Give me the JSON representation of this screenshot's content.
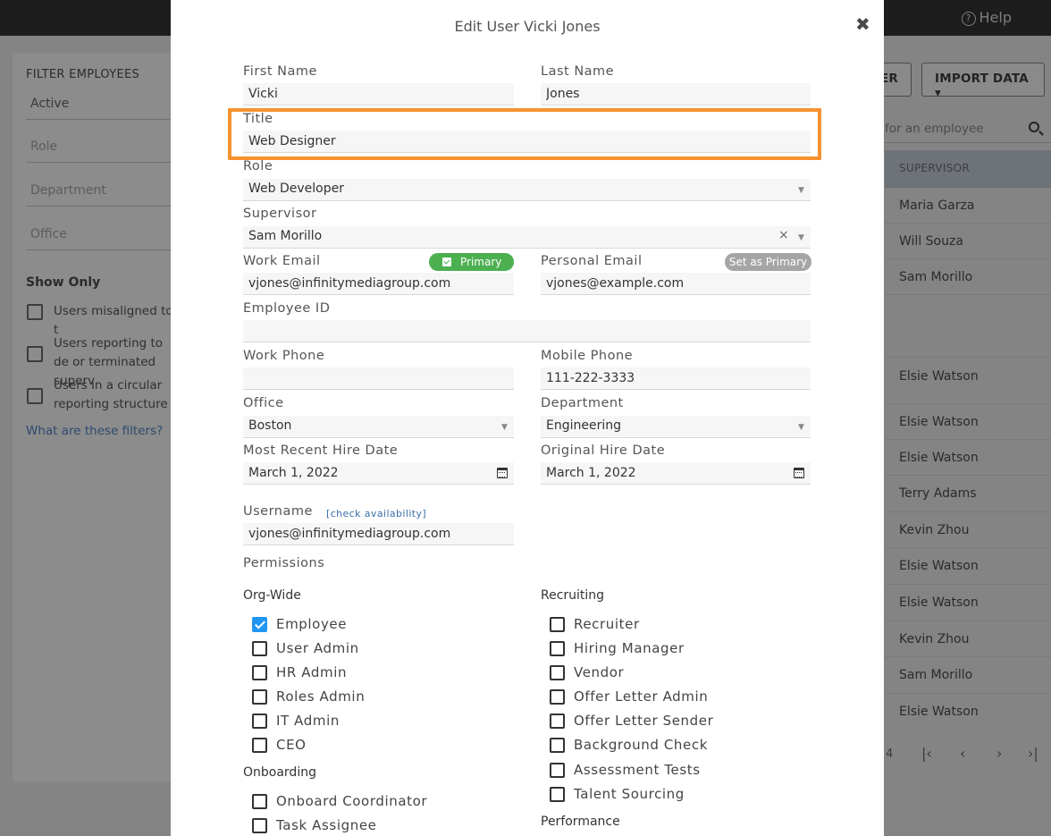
{
  "background": {
    "help_label": "Help",
    "filter": {
      "title": "FILTER EMPLOYEES",
      "status_value": "Active",
      "role_placeholder": "Role",
      "department_placeholder": "Department",
      "office_placeholder": "Office",
      "show_only": "Show Only",
      "options": [
        "Users misaligned to t",
        "Users reporting to de or terminated superv",
        "Users in a circular reporting structure"
      ],
      "help_link": "What are these filters?"
    },
    "buttons": {
      "partial": "ER",
      "import": "IMPORT DATA ▾"
    },
    "search_placeholder": "for an employee",
    "supervisor_header": "SUPERVISOR",
    "supervisor_rows": [
      "Maria Garza",
      "Will Souza",
      "Sam Morillo",
      "Elsie Watson",
      "Elsie Watson",
      "Elsie Watson",
      "Terry Adams",
      "Kevin Zhou",
      "Elsie Watson",
      "Elsie Watson",
      "Kevin Zhou",
      "Sam Morillo",
      "Elsie Watson"
    ],
    "pager": {
      "page": "4",
      "first": "|‹",
      "prev": "‹",
      "next": "›",
      "last": "›|"
    }
  },
  "modal": {
    "title": "Edit User Vicki Jones",
    "close": "✖",
    "first_name": {
      "label": "First Name",
      "value": "Vicki"
    },
    "last_name": {
      "label": "Last Name",
      "value": "Jones"
    },
    "title_field": {
      "label": "Title",
      "value": "Web Designer"
    },
    "role": {
      "label": "Role",
      "value": "Web Developer"
    },
    "supervisor": {
      "label": "Supervisor",
      "value": "Sam Morillo",
      "clear": "×"
    },
    "work_email": {
      "label": "Work Email",
      "value": "vjones@infinitymediagroup.com",
      "badge": "Primary"
    },
    "personal_email": {
      "label": "Personal Email",
      "value": "vjones@example.com",
      "badge": "Set as Primary"
    },
    "employee_id": {
      "label": "Employee ID",
      "value": ""
    },
    "work_phone": {
      "label": "Work Phone",
      "value": ""
    },
    "mobile_phone": {
      "label": "Mobile Phone",
      "value": "111-222-3333"
    },
    "office": {
      "label": "Office",
      "value": "Boston"
    },
    "department": {
      "label": "Department",
      "value": "Engineering"
    },
    "recent_hire": {
      "label": "Most Recent Hire Date",
      "value": "March 1, 2022"
    },
    "original_hire": {
      "label": "Original Hire Date",
      "value": "March 1, 2022"
    },
    "username": {
      "label": "Username",
      "value": "vjones@infinitymediagroup.com",
      "check": "[check availability]"
    },
    "permissions": {
      "heading": "Permissions",
      "org_wide": {
        "heading": "Org-Wide",
        "items": [
          {
            "label": "Employee",
            "checked": true
          },
          {
            "label": "User Admin",
            "checked": false
          },
          {
            "label": "HR Admin",
            "checked": false
          },
          {
            "label": "Roles Admin",
            "checked": false
          },
          {
            "label": "IT Admin",
            "checked": false
          },
          {
            "label": "CEO",
            "checked": false
          }
        ]
      },
      "onboarding": {
        "heading": "Onboarding",
        "items": [
          {
            "label": "Onboard Coordinator",
            "checked": false
          },
          {
            "label": "Task Assignee",
            "checked": false
          }
        ]
      },
      "recruiting": {
        "heading": "Recruiting",
        "items": [
          {
            "label": "Recruiter",
            "checked": false
          },
          {
            "label": "Hiring Manager",
            "checked": false
          },
          {
            "label": "Vendor",
            "checked": false
          },
          {
            "label": "Offer Letter Admin",
            "checked": false
          },
          {
            "label": "Offer Letter Sender",
            "checked": false
          },
          {
            "label": "Background Check",
            "checked": false
          },
          {
            "label": "Assessment Tests",
            "checked": false
          },
          {
            "label": "Talent Sourcing",
            "checked": false
          }
        ]
      },
      "performance": {
        "heading": "Performance"
      }
    }
  },
  "colors": {
    "highlight": "#f5922f",
    "primary_badge": "#4caf50",
    "checkbox_checked": "#2196f3"
  }
}
